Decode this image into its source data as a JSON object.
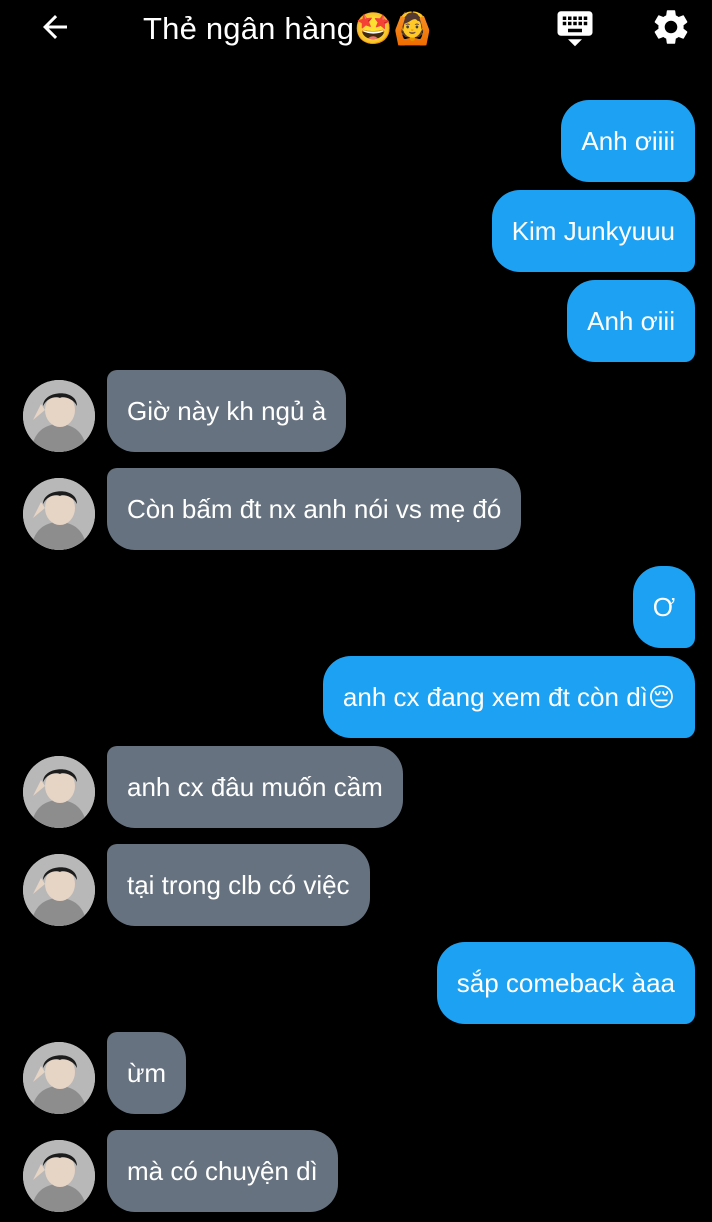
{
  "header": {
    "title": "Thẻ ngân hàng🤩🙆",
    "back_icon": "arrow-left-icon",
    "keyboard_icon": "keyboard-icon",
    "settings_icon": "gear-icon"
  },
  "colors": {
    "outgoing_bubble": "#1da1f2",
    "incoming_bubble": "#66727f",
    "background": "#000000"
  },
  "messages": [
    {
      "side": "out",
      "text": "Anh ơiiii"
    },
    {
      "side": "out",
      "text": "Kim Junkyuuu"
    },
    {
      "side": "out",
      "text": "Anh ơiii"
    },
    {
      "side": "in",
      "text": "Giờ này kh ngủ à"
    },
    {
      "side": "in",
      "text": "Còn bấm đt nx anh nói vs mẹ đó"
    },
    {
      "side": "out",
      "text": "Ơ"
    },
    {
      "side": "out",
      "text": "anh cx đang xem đt còn dì😔"
    },
    {
      "side": "in",
      "text": "anh cx đâu muốn cầm"
    },
    {
      "side": "in",
      "text": "tại trong clb có việc"
    },
    {
      "side": "out",
      "text": "sắp comeback àaa"
    },
    {
      "side": "in",
      "text": "ừm"
    },
    {
      "side": "in",
      "text": "mà có chuyện dì"
    }
  ]
}
